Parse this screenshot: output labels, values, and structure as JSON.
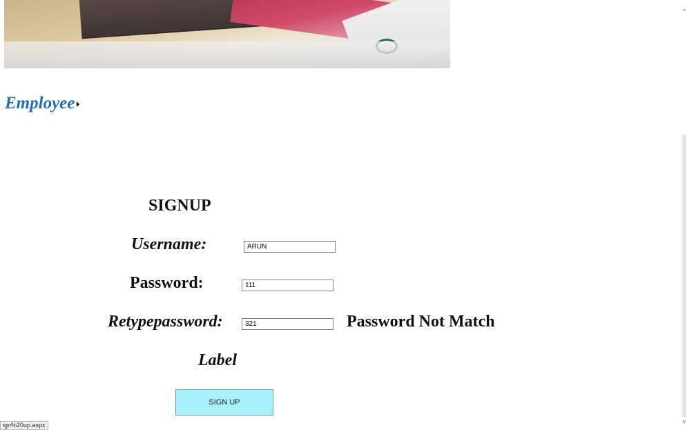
{
  "banner": {
    "image": "chocolate-bar-photo",
    "overlay_text": ""
  },
  "menu": {
    "item_label": "Employee",
    "arrow_icon": "submenu-arrow-icon"
  },
  "form": {
    "title": "SIGNUP",
    "username_label": "Username:",
    "username_value": "ARUN",
    "password_label": "Password:",
    "password_value": "111",
    "retype_label": "Retypepassword:",
    "retype_value": "321",
    "error_message": "Password Not Match",
    "extra_label": "Label",
    "submit_label": "SIGN UP"
  },
  "status": {
    "url": "ign%20up.aspx"
  },
  "colors": {
    "menu_link": "#1f70b5",
    "button_bg": "#a8f0fa"
  }
}
